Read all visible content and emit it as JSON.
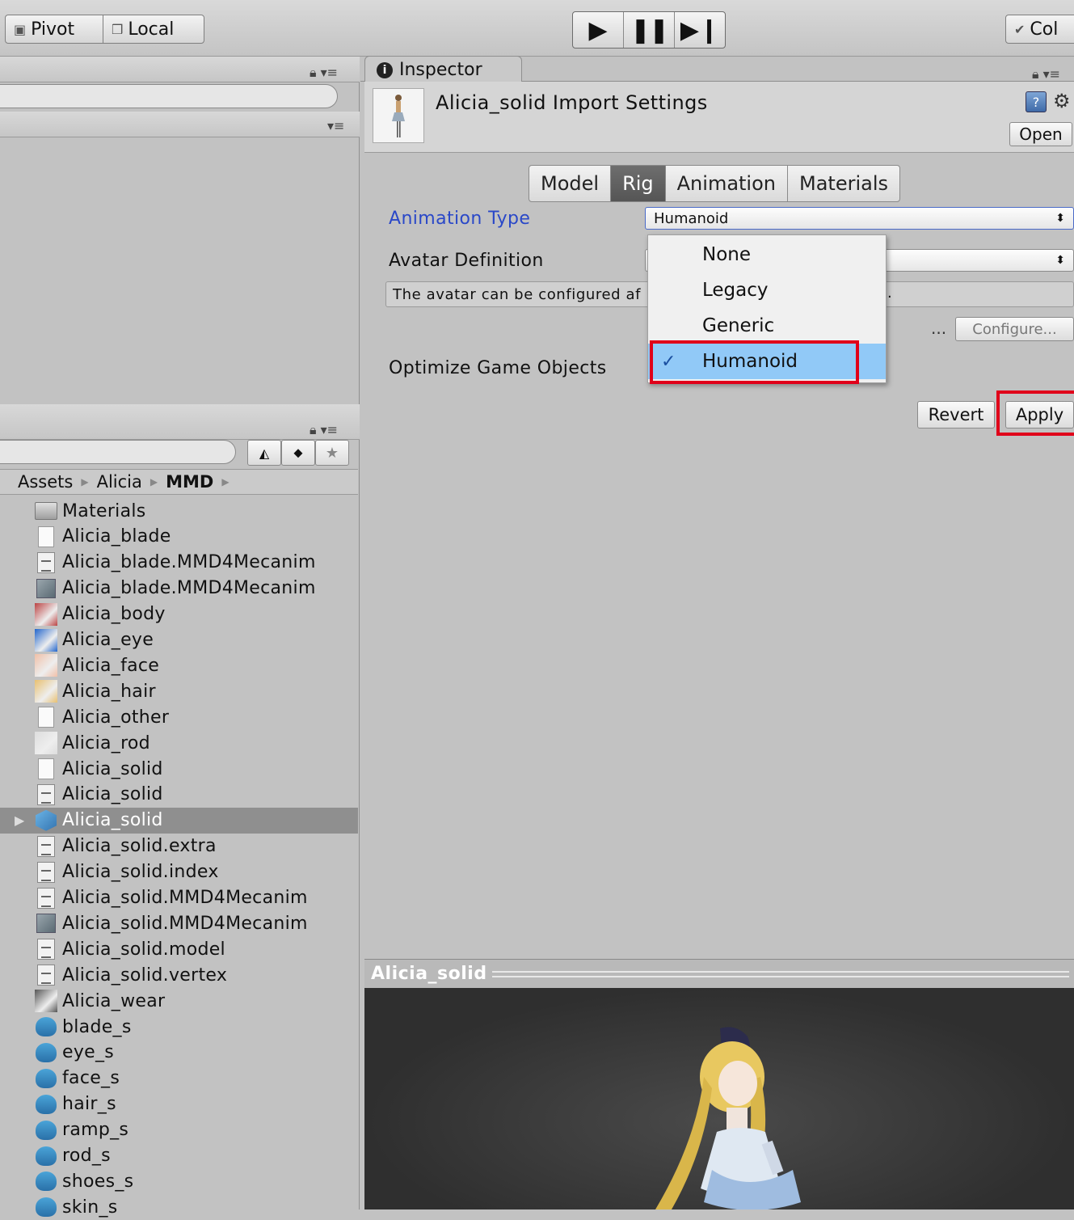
{
  "toolbar": {
    "pivot_label": "Pivot",
    "local_label": "Local",
    "collab_label": "Col"
  },
  "project": {
    "breadcrumb": [
      "Assets",
      "Alicia",
      "MMD"
    ],
    "items": [
      {
        "name": "Materials",
        "icon": "folder-icon"
      },
      {
        "name": "Alicia_blade",
        "icon": "document-icon"
      },
      {
        "name": "Alicia_blade.MMD4Mecanim",
        "icon": "text-file-icon"
      },
      {
        "name": "Alicia_blade.MMD4Mecanim",
        "icon": "unity-asset-icon"
      },
      {
        "name": "Alicia_body",
        "icon": "texture-icon"
      },
      {
        "name": "Alicia_eye",
        "icon": "texture-icon"
      },
      {
        "name": "Alicia_face",
        "icon": "texture-icon"
      },
      {
        "name": "Alicia_hair",
        "icon": "texture-icon"
      },
      {
        "name": "Alicia_other",
        "icon": "document-icon"
      },
      {
        "name": "Alicia_rod",
        "icon": "texture-icon"
      },
      {
        "name": "Alicia_solid",
        "icon": "document-icon"
      },
      {
        "name": "Alicia_solid",
        "icon": "text-file-icon"
      },
      {
        "name": "Alicia_solid",
        "icon": "model-icon",
        "selected": true
      },
      {
        "name": "Alicia_solid.extra",
        "icon": "text-file-icon"
      },
      {
        "name": "Alicia_solid.index",
        "icon": "text-file-icon"
      },
      {
        "name": "Alicia_solid.MMD4Mecanim",
        "icon": "text-file-icon"
      },
      {
        "name": "Alicia_solid.MMD4Mecanim",
        "icon": "unity-asset-icon"
      },
      {
        "name": "Alicia_solid.model",
        "icon": "text-file-icon"
      },
      {
        "name": "Alicia_solid.vertex",
        "icon": "text-file-icon"
      },
      {
        "name": "Alicia_wear",
        "icon": "texture-icon"
      },
      {
        "name": "blade_s",
        "icon": "shader-icon"
      },
      {
        "name": "eye_s",
        "icon": "shader-icon"
      },
      {
        "name": "face_s",
        "icon": "shader-icon"
      },
      {
        "name": "hair_s",
        "icon": "shader-icon"
      },
      {
        "name": "ramp_s",
        "icon": "shader-icon"
      },
      {
        "name": "rod_s",
        "icon": "shader-icon"
      },
      {
        "name": "shoes_s",
        "icon": "shader-icon"
      },
      {
        "name": "skin_s",
        "icon": "shader-icon"
      }
    ]
  },
  "inspector": {
    "tab_label": "Inspector",
    "title": "Alicia_solid Import Settings",
    "open_label": "Open",
    "tabs": [
      "Model",
      "Rig",
      "Animation",
      "Materials"
    ],
    "active_tab": "Rig",
    "animation_type_label": "Animation Type",
    "animation_type_value": "Humanoid",
    "avatar_definition_label": "Avatar Definition",
    "info_text": "The avatar can be configured af",
    "info_suffix": ".",
    "ellipsis": "...",
    "configure_label": "Configure...",
    "optimize_label": "Optimize Game Objects",
    "revert_label": "Revert",
    "apply_label": "Apply",
    "dropdown_options": [
      "None",
      "Legacy",
      "Generic",
      "Humanoid"
    ],
    "selected_option": "Humanoid"
  },
  "preview": {
    "title": "Alicia_solid"
  },
  "colors": {
    "highlight_red": "#e0001a",
    "selection_blue": "#91c9f7",
    "label_blue": "#2a48c8"
  }
}
